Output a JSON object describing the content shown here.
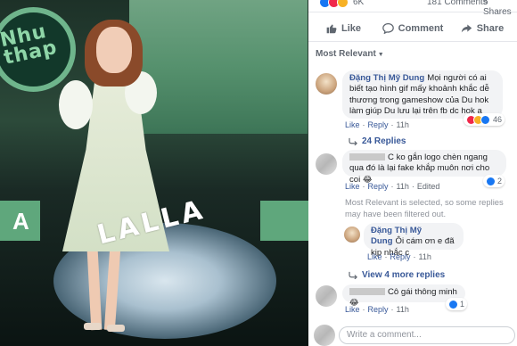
{
  "photo": {
    "logo_text": "Nhu\nthap",
    "watermark": "LALLA",
    "tile_letter": "A"
  },
  "stats": {
    "reaction_count": "6K",
    "comments": "181 Comments",
    "shares": "5 Shares"
  },
  "actions": {
    "like": "Like",
    "comment": "Comment",
    "share": "Share"
  },
  "sort": {
    "label": "Most Relevant"
  },
  "comments": [
    {
      "author": "Đặng Thị Mỹ Dung",
      "text": "Mọi người có ai biết tạo hình gif mấy khoảnh khắc dễ thương trong gameshow của Du hok làm giúp Du lưu lại trên fb dc hok ạ",
      "like": "Like",
      "reply": "Reply",
      "time": "11h",
      "reaction_count": "46"
    },
    {
      "text": "C ko gắn logo chèn ngang qua đó là lại fake khắp muôn nơi cho coi",
      "emoji": "😂",
      "like": "Like",
      "reply": "Reply",
      "time": "11h",
      "edited": "Edited",
      "reaction_count": "2"
    },
    {
      "author": "Đặng Thị Mỹ Dung",
      "text": "Ôi cám ơn e đã kịp nhắc c",
      "like": "Like",
      "reply": "Reply",
      "time": "11h"
    },
    {
      "text": "Cô gái thông minh",
      "emoji": "😂",
      "like": "Like",
      "reply": "Reply",
      "time": "11h",
      "reaction_count": "1"
    }
  ],
  "replies_link": "24 Replies",
  "filter_notice": "Most Relevant is selected, so some replies may have been filtered out.",
  "more_replies": "View 4 more replies",
  "write_placeholder": "Write a comment...",
  "colors": {
    "link": "#385898",
    "like": "#1877f2",
    "love": "#f0284a",
    "haha": "#f7b125"
  }
}
